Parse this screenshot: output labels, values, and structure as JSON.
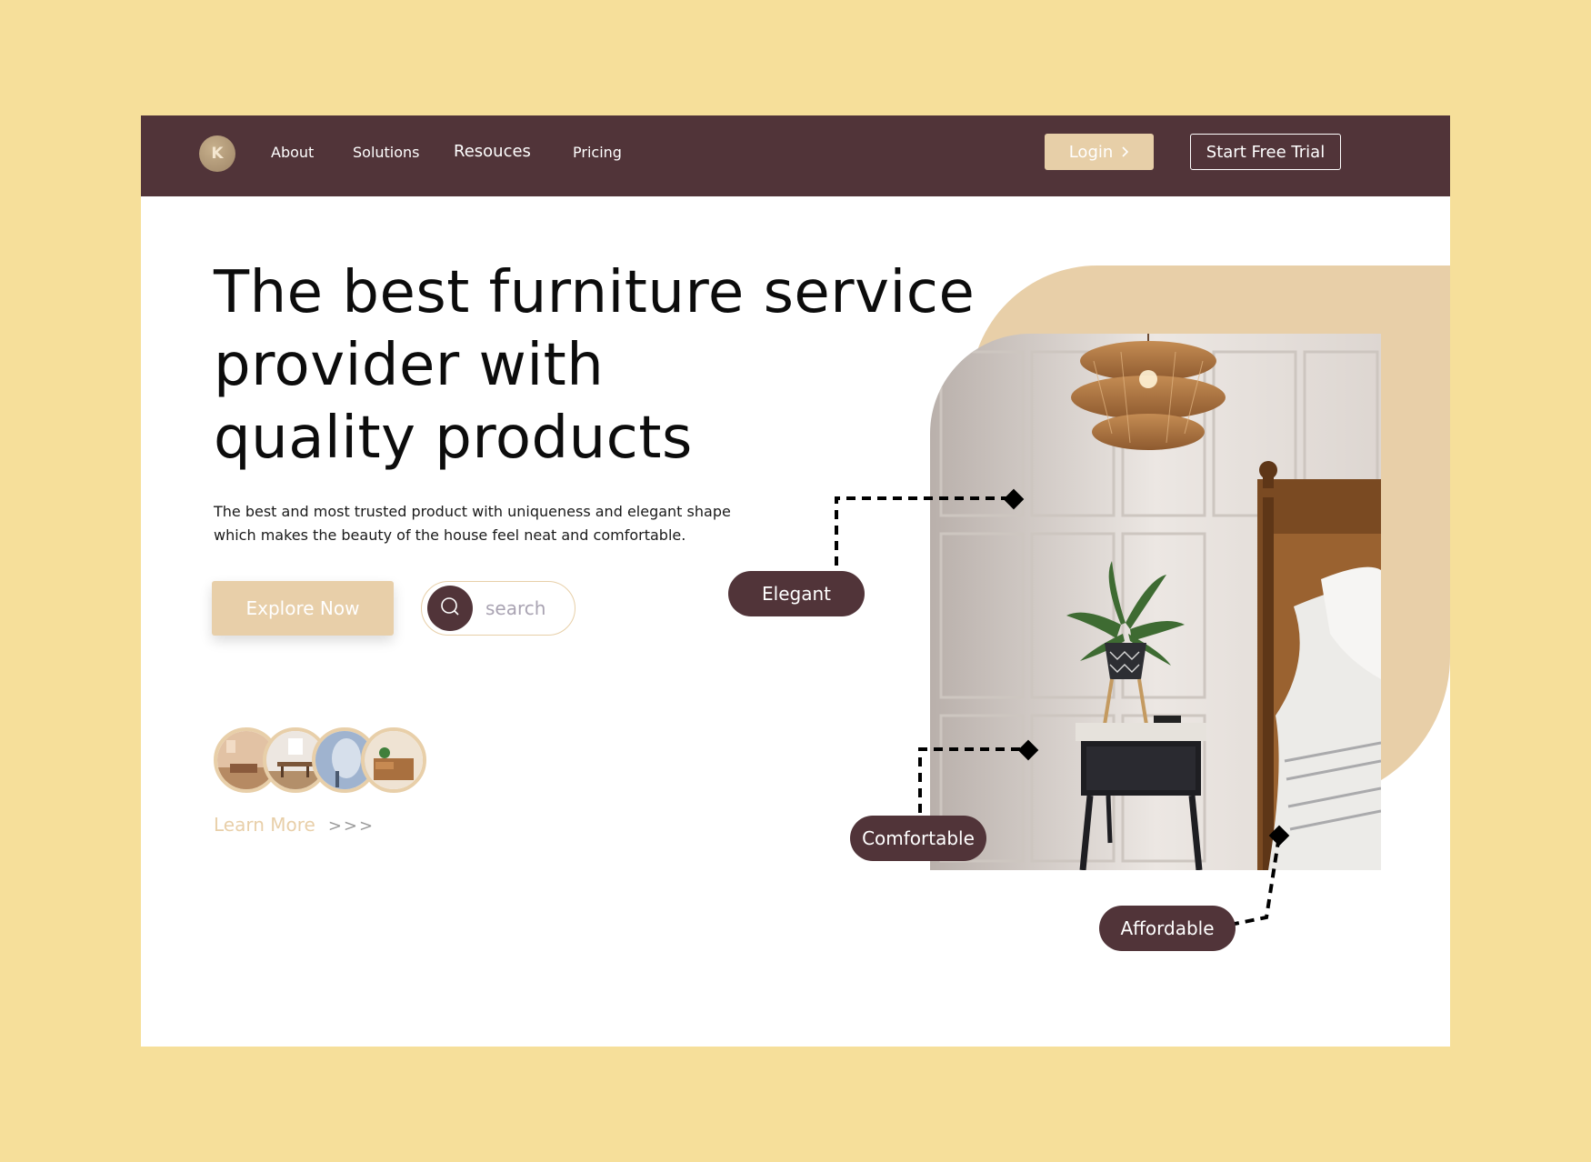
{
  "brand": {
    "logo_letter": "K"
  },
  "nav": {
    "links": [
      "About",
      "Solutions",
      "Resouces",
      "Pricing"
    ],
    "login_label": "Login",
    "trial_label": "Start Free Trial"
  },
  "hero": {
    "title_lines": [
      "The best furniture service",
      "provider with",
      "quality products"
    ],
    "desc_lines": [
      "The best and most trusted product with uniqueness and elegant shape",
      "which makes the beauty of the house feel neat and comfortable."
    ],
    "explore_label": "Explore Now",
    "search_placeholder": "search",
    "learn_more_label": "Learn More",
    "learn_more_arrows": ">>>"
  },
  "tags": [
    "Elegant",
    "Comfortable",
    "Affordable"
  ],
  "colors": {
    "background": "#f6df9a",
    "nav": "#513439",
    "accent": "#e8cfa8",
    "tag": "#513439"
  },
  "icons": {
    "search": "search-icon",
    "login_chevron": "chevron-right-icon",
    "learn_more": "triple-chevron-right-icon"
  }
}
